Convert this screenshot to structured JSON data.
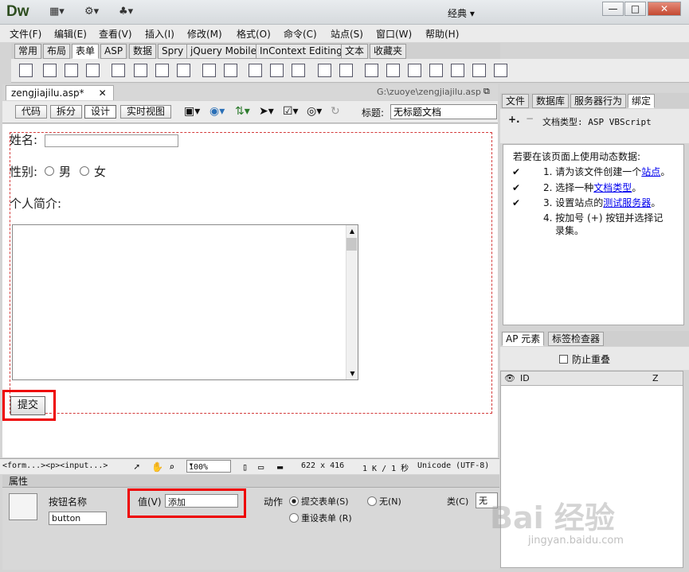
{
  "app": {
    "logo": "Dw",
    "workspace": "经典"
  },
  "menu": [
    "文件(F)",
    "编辑(E)",
    "查看(V)",
    "插入(I)",
    "修改(M)",
    "格式(O)",
    "命令(C)",
    "站点(S)",
    "窗口(W)",
    "帮助(H)"
  ],
  "insert_tabs": [
    "常用",
    "布局",
    "表单",
    "ASP",
    "数据",
    "Spry",
    "jQuery Mobile",
    "InContext Editing",
    "文本",
    "收藏夹"
  ],
  "document": {
    "tab": "zengjiajilu.asp*",
    "path": "G:\\zuoye\\zengjiajilu.asp"
  },
  "view": {
    "code": "代码",
    "split": "拆分",
    "design": "设计",
    "live": "实时视图",
    "title_label": "标题:",
    "title_value": "无标题文档"
  },
  "form": {
    "name_label": "姓名:",
    "gender_label": "性别:",
    "male": "男",
    "female": "女",
    "bio_label": "个人简介:",
    "submit": "提交"
  },
  "status": {
    "tags": "<form...><p><input...>",
    "zoom": "100%",
    "size": "622 x 416",
    "info": "1 K / 1 秒",
    "encoding": "Unicode (UTF-8)"
  },
  "properties": {
    "header": "属性",
    "button_name_label": "按钮名称",
    "button_name_value": "button",
    "value_label": "值(V)",
    "value_value": "添加",
    "action_label": "动作",
    "submit_form": "提交表单(S)",
    "none": "无(N)",
    "reset_form": "重设表单 (R)",
    "class_label": "类(C)",
    "class_value": "无"
  },
  "right_panel": {
    "tabs": [
      "文件",
      "数据库",
      "服务器行为",
      "绑定"
    ],
    "doc_type": "文档类型: ASP VBScript",
    "intro": "若要在该页面上使用动态数据:",
    "steps": [
      {
        "num": "1.",
        "pre": "请为该文件创建一个",
        "link": "站点",
        "post": "。"
      },
      {
        "num": "2.",
        "pre": "选择一种",
        "link": "文档类型",
        "post": "。"
      },
      {
        "num": "3.",
        "pre": "设置站点的",
        "link": "测试服务器",
        "post": "。"
      },
      {
        "num": "4.",
        "pre": "按加号 (+) 按钮并选择记录集。",
        "link": "",
        "post": ""
      }
    ]
  },
  "ap_panel": {
    "tabs": [
      "AP 元素",
      "标签检查器"
    ],
    "prevent_overlap": "防止重叠",
    "col_id": "ID",
    "col_z": "Z"
  },
  "watermark": {
    "main": "Bai 经验",
    "sub": "jingyan.baidu.com"
  }
}
